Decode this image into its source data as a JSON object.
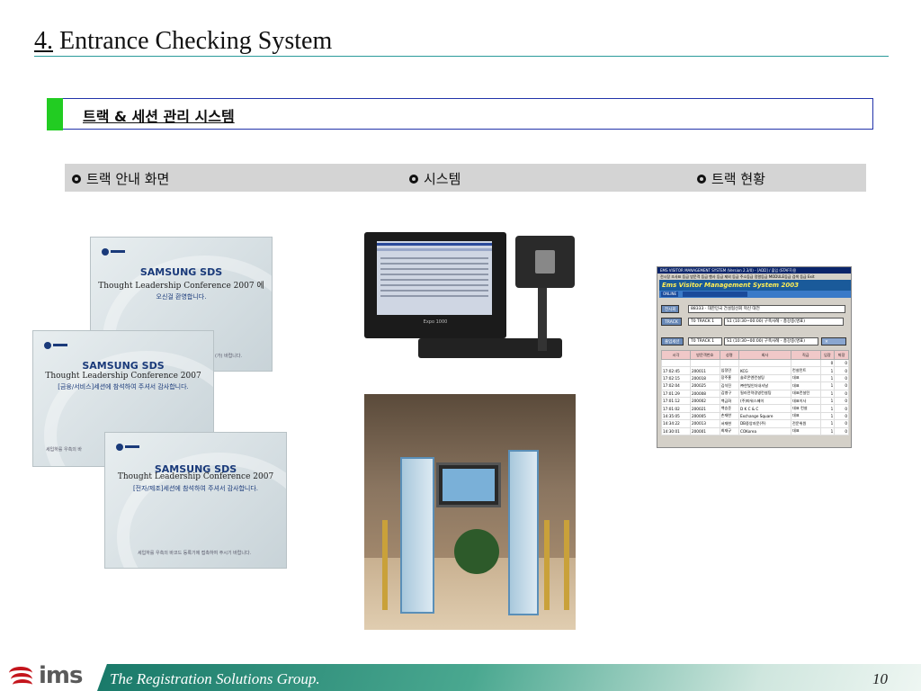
{
  "title": {
    "number": "4.",
    "text": "Entrance Checking System"
  },
  "section": {
    "title": "트랙 & 세션 관리 시스템",
    "accent_color": "#22cc22",
    "border_color": "#2233aa"
  },
  "labels": [
    {
      "text": "트랙 안내 화면",
      "icon": "bullet-icon"
    },
    {
      "text": "시스템",
      "icon": "bullet-icon"
    },
    {
      "text": "트랙 현황",
      "icon": "bullet-icon"
    }
  ],
  "cards": [
    {
      "brand": "SAMSUNG SDS",
      "conference": "Thought Leadership Conference 2007 에",
      "message": "오신걸 환영합니다.",
      "footer": "(가) 바랍니다."
    },
    {
      "brand": "SAMSUNG SDS",
      "conference": "Thought Leadership Conference 2007",
      "message": "[금융/서비스]세션에 참석하여 주셔서 감사합니다.",
      "footer": "세입하를 우측의 바"
    },
    {
      "brand": "SAMSUNG SDS",
      "conference": "Thought Leadership Conference 2007",
      "message": "[전자/제조]세션에 참석하여 주셔서 감사합니다.",
      "footer": "세입하를 우측의 바코드 등록기에 접촉하여 주시기 바랍니다."
    }
  ],
  "terminal": {
    "brand": "Expo 1000"
  },
  "track_window": {
    "titlebar": "EMS VISITOR MANAGEMENT SYSTEM (Version 2.3/0) - [ADD] / 출입 (STAFF)용",
    "menubar": "전시장 조사표 등급 방문객 등급 행사 등급 제외 등급 주소등급 정렬등급 MODULE등급 검색 등급 Exit",
    "banner": "Ems Visitor Management System 2003",
    "tabs": [
      "ONLINE",
      "",
      "",
      ""
    ],
    "exhibit_label": "전시회",
    "exhibit_value": "88333 · 대한민국 건설협선회 혁신 대전",
    "track_label": "TRACK",
    "track_value": "T0 TRACK 1",
    "track_session": "S1 (10:30~00:00) 구축사례 - 총강중(명표)",
    "session_label": "출입세션",
    "session_value": "T0 TRACK 1",
    "session_session": "S1 (10:30~00:00) 구축사례 - 총강중(명표)",
    "columns": [
      "시각",
      "방문객번호",
      "성명",
      "회사",
      "직급",
      "입장",
      "퇴장"
    ],
    "rows": [
      [
        "",
        "",
        "",
        "",
        "",
        "0",
        "0"
      ],
      [
        "17:02:45",
        "200011",
        "임정민",
        "KCG",
        "컨설턴트",
        "1",
        "0"
      ],
      [
        "17:02:15",
        "200018",
        "장주홍",
        "솔로몬엔컨설팅",
        "대표",
        "1",
        "0"
      ],
      [
        "17:02:04",
        "200025",
        "김석진",
        "㈜한빛인더내셔날",
        "대표",
        "1",
        "0"
      ],
      [
        "17:01:29",
        "200008",
        "김병구",
        "필라전략경영컨설팅",
        "대표컨설턴",
        "1",
        "0"
      ],
      [
        "17:01:12",
        "200002",
        "백금화",
        "(주)파워스페이",
        "대표이사",
        "1",
        "0"
      ],
      [
        "17:01:02",
        "200021",
        "백승준",
        "D K C & C",
        "대표 컨설",
        "1",
        "0"
      ],
      [
        "14:35:05",
        "200005",
        "손재한",
        "Exchange Square",
        "대표",
        "1",
        "0"
      ],
      [
        "14:34:22",
        "200013",
        "서재현",
        "DB중앙자문(주)",
        "전문위원",
        "1",
        "0"
      ],
      [
        "14:30:01",
        "200001",
        "최재규",
        "COKorea",
        "대표",
        "1",
        "0"
      ]
    ]
  },
  "footer": {
    "brand": "ims",
    "tagline": "The Registration Solutions Group.",
    "page": "10",
    "accent": "#c4151c"
  }
}
